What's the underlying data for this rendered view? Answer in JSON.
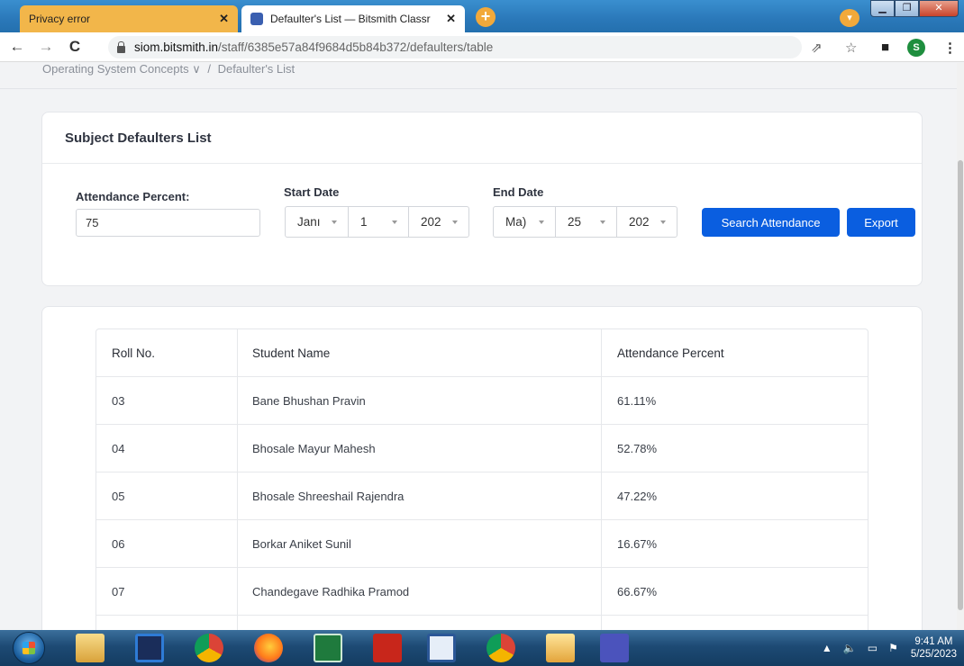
{
  "browser": {
    "tabs": [
      {
        "title": "Privacy error",
        "active": false
      },
      {
        "title": "Defaulter's List — Bitsmith Classr",
        "active": true
      }
    ],
    "new_tab_label": "+",
    "address": {
      "host": "siom.bitsmith.in",
      "path": "/staff/6385e57a84f9684d5b84b372/defaulters/table"
    },
    "profile_initial": "S"
  },
  "breadcrumb": {
    "course": "Operating System Concepts ∨",
    "separator": "/",
    "current": "Defaulter's List"
  },
  "filter_card": {
    "title": "Subject Defaulters List",
    "attendance_label": "Attendance Percent:",
    "attendance_value": "75",
    "start_label": "Start Date",
    "start": {
      "month": "Janı",
      "day": "1",
      "year": "202"
    },
    "end_label": "End Date",
    "end": {
      "month": "Ma)",
      "day": "25",
      "year": "202"
    },
    "search_button": "Search Attendance",
    "export_button": "Export"
  },
  "table": {
    "headers": [
      "Roll No.",
      "Student Name",
      "Attendance Percent"
    ],
    "rows": [
      {
        "roll": "03",
        "name": "Bane Bhushan Pravin",
        "percent": "61.11%"
      },
      {
        "roll": "04",
        "name": "Bhosale Mayur Mahesh",
        "percent": "52.78%"
      },
      {
        "roll": "05",
        "name": "Bhosale Shreeshail Rajendra",
        "percent": "47.22%"
      },
      {
        "roll": "06",
        "name": "Borkar Aniket Sunil",
        "percent": "16.67%"
      },
      {
        "roll": "07",
        "name": "Chandegave Radhika Pramod",
        "percent": "66.67%"
      },
      {
        "roll": "",
        "name": "",
        "percent": ""
      }
    ]
  },
  "taskbar": {
    "time": "9:41 AM",
    "date": "5/25/2023",
    "apps": [
      "file-explorer",
      "media-player",
      "chrome",
      "firefox",
      "excel",
      "acrobat",
      "word",
      "chrome-profile",
      "outlook",
      "teams"
    ]
  },
  "colors": {
    "primary_button": "#0a5ee0",
    "tab_inactive": "#f2b64a",
    "page_bg": "#f2f3f5"
  }
}
